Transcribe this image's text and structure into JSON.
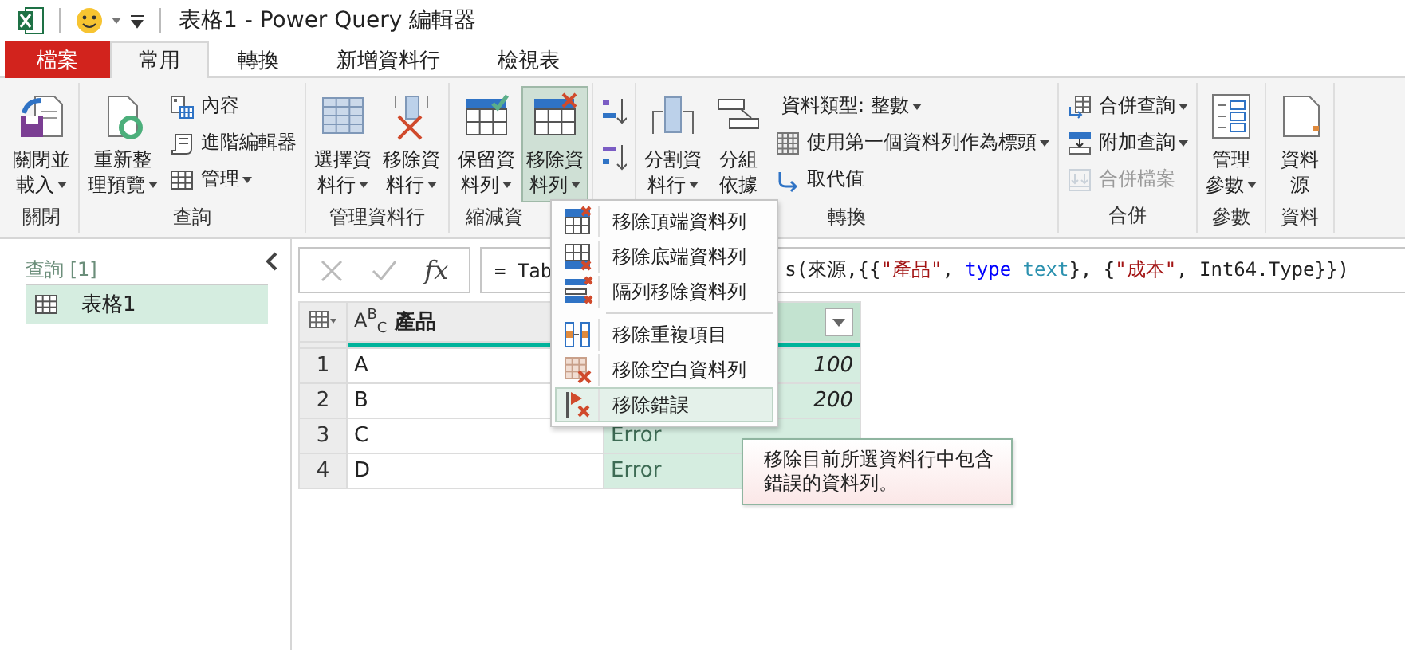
{
  "window": {
    "title": "表格1 - Power Query 編輯器"
  },
  "tabs": [
    {
      "label": "檔案",
      "kind": "file",
      "selected": false
    },
    {
      "label": "常用",
      "kind": "tab",
      "selected": true
    },
    {
      "label": "轉換",
      "kind": "tab",
      "selected": false
    },
    {
      "label": "新增資料行",
      "kind": "tab",
      "selected": false
    },
    {
      "label": "檢視表",
      "kind": "tab",
      "selected": false
    }
  ],
  "ribbon": {
    "groups": [
      {
        "label": "關閉",
        "items": [
          {
            "kind": "large",
            "lines": [
              "關閉並",
              "載入"
            ],
            "dropdown": true,
            "pressed": false,
            "disabled": false
          }
        ]
      },
      {
        "label": "查詢",
        "items": [
          {
            "kind": "large",
            "lines": [
              "重新整",
              "理預覽"
            ],
            "dropdown": true,
            "pressed": false,
            "disabled": false
          },
          {
            "kind": "small",
            "lines": [
              "內容"
            ],
            "dropdown": false,
            "pressed": false,
            "disabled": false
          },
          {
            "kind": "small",
            "lines": [
              "進階編輯器"
            ],
            "dropdown": false,
            "pressed": false,
            "disabled": false
          },
          {
            "kind": "small",
            "lines": [
              "管理"
            ],
            "dropdown": true,
            "pressed": false,
            "disabled": false
          }
        ]
      },
      {
        "label": "管理資料行",
        "items": [
          {
            "kind": "large",
            "lines": [
              "選擇資",
              "料行"
            ],
            "dropdown": true,
            "pressed": false,
            "disabled": false
          },
          {
            "kind": "large",
            "lines": [
              "移除資",
              "料行"
            ],
            "dropdown": true,
            "pressed": false,
            "disabled": false
          }
        ]
      },
      {
        "label": "縮減資",
        "items": [
          {
            "kind": "large",
            "lines": [
              "保留資",
              "料列"
            ],
            "dropdown": true,
            "pressed": false,
            "disabled": false
          },
          {
            "kind": "large",
            "lines": [
              "移除資",
              "料列"
            ],
            "dropdown": true,
            "pressed": true,
            "disabled": false
          }
        ]
      },
      {
        "items": [
          {
            "kind": "icon",
            "pressed": false,
            "disabled": false
          },
          {
            "kind": "icon",
            "pressed": false,
            "disabled": false
          }
        ]
      },
      {
        "label": "轉換",
        "items": [
          {
            "kind": "large",
            "lines": [
              "分割資",
              "料行"
            ],
            "dropdown": true,
            "pressed": false,
            "disabled": false
          },
          {
            "kind": "large",
            "lines": [
              "分組",
              "依據"
            ],
            "dropdown": false,
            "pressed": false,
            "disabled": false
          },
          {
            "kind": "small",
            "lines": [
              "資料類型: 整數"
            ],
            "dropdown": true,
            "pressed": false,
            "disabled": false
          },
          {
            "kind": "small",
            "lines": [
              "使用第一個資料列作為標頭"
            ],
            "dropdown": true,
            "pressed": false,
            "disabled": false
          },
          {
            "kind": "small",
            "lines": [
              "取代值"
            ],
            "dropdown": false,
            "pressed": false,
            "disabled": false
          }
        ]
      },
      {
        "label": "合併",
        "items": [
          {
            "kind": "small",
            "lines": [
              "合併查詢"
            ],
            "dropdown": true,
            "pressed": false,
            "disabled": false
          },
          {
            "kind": "small",
            "lines": [
              "附加查詢"
            ],
            "dropdown": true,
            "pressed": false,
            "disabled": false
          },
          {
            "kind": "small",
            "lines": [
              "合併檔案"
            ],
            "dropdown": false,
            "pressed": false,
            "disabled": true
          }
        ]
      },
      {
        "label": "參數",
        "items": [
          {
            "kind": "large",
            "lines": [
              "管理",
              "參數"
            ],
            "dropdown": true,
            "pressed": false,
            "disabled": false
          }
        ]
      },
      {
        "label": "資料",
        "items": [
          {
            "kind": "large",
            "lines": [
              "資料",
              "源"
            ],
            "dropdown": false,
            "pressed": false,
            "disabled": false
          }
        ]
      }
    ]
  },
  "queries_panel": {
    "header": "查詢 [1]",
    "items": [
      {
        "label": "表格1",
        "selected": true
      }
    ]
  },
  "formula_bar": {
    "fx": "fx",
    "start": "= Tab",
    "tokens": [
      {
        "text": "s(來源,{{",
        "kind": "plain"
      },
      {
        "text": "\"產品\"",
        "kind": "string"
      },
      {
        "text": ", ",
        "kind": "plain"
      },
      {
        "text": "type",
        "kind": "keyword"
      },
      {
        "text": " text",
        "kind": "type"
      },
      {
        "text": "}, {",
        "kind": "plain"
      },
      {
        "text": "\"成本\"",
        "kind": "string"
      },
      {
        "text": ", Int64.Type}})",
        "kind": "plain"
      }
    ]
  },
  "table": {
    "columns": [
      {
        "name": "產品",
        "type_label": "A$^{B}$$_{C}$",
        "selected": false
      },
      {
        "selected": true
      }
    ],
    "rows": [
      {
        "number": "1",
        "cells": [
          {
            "text": "A",
            "kind": "text"
          },
          {
            "text": "100",
            "kind": "number"
          }
        ]
      },
      {
        "number": "2",
        "cells": [
          {
            "text": "B",
            "kind": "text"
          },
          {
            "text": "200",
            "kind": "number"
          }
        ]
      },
      {
        "number": "3",
        "cells": [
          {
            "text": "C",
            "kind": "text"
          },
          {
            "text": "Error",
            "kind": "error"
          }
        ]
      },
      {
        "number": "4",
        "cells": [
          {
            "text": "D",
            "kind": "text"
          },
          {
            "text": "Error",
            "kind": "error"
          }
        ]
      }
    ]
  },
  "menu": {
    "sections": [
      [
        {
          "label": "移除頂端資料列",
          "selected": false
        },
        {
          "label": "移除底端資料列",
          "selected": false
        },
        {
          "label": "隔列移除資料列",
          "selected": false
        }
      ],
      [
        {
          "label": "移除重複項目",
          "selected": false
        },
        {
          "label": "移除空白資料列",
          "selected": false
        },
        {
          "label": "移除錯誤",
          "selected": true
        }
      ]
    ]
  },
  "tooltip": {
    "text": "移除目前所選資料行中包含錯誤的資料列。"
  }
}
